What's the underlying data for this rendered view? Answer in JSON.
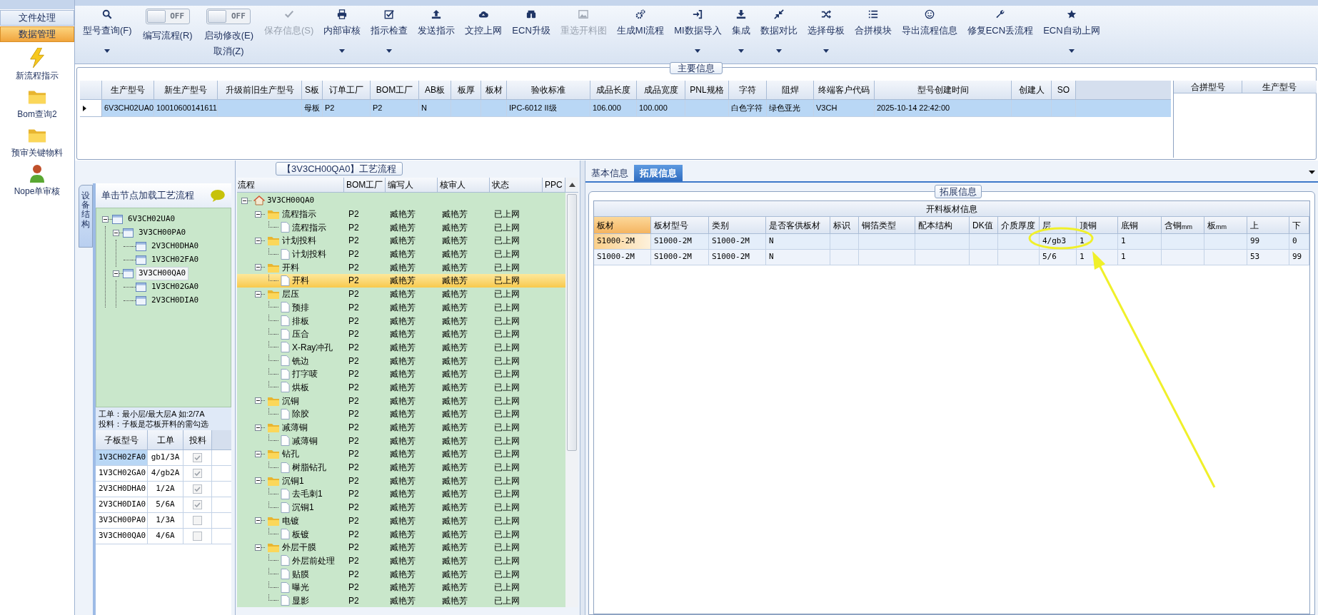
{
  "sidebar": {
    "sections": [
      {
        "label": "文件处理",
        "selected": false
      },
      {
        "label": "数据管理",
        "selected": true
      }
    ],
    "shortcuts": [
      {
        "label": "新流程指示"
      },
      {
        "label": "Bom查询2"
      },
      {
        "label": "预审关键物料"
      },
      {
        "label": "Nope单审核"
      }
    ]
  },
  "toolbar": [
    {
      "kind": "button",
      "label": "型号查询(F)",
      "dropdown": true,
      "disabled": false
    },
    {
      "kind": "toggle",
      "label": "编写流程(R)",
      "switch_text": "OFF",
      "on": false
    },
    {
      "kind": "toggle",
      "label": "启动修改(E)",
      "sublabel": "取消(Z)",
      "switch_text": "OFF",
      "on": false
    },
    {
      "kind": "button",
      "label": "保存信息(S)",
      "dropdown": false,
      "disabled": true
    },
    {
      "kind": "button",
      "label": "内部审核",
      "dropdown": true,
      "disabled": false
    },
    {
      "kind": "button",
      "label": "指示检查",
      "dropdown": true,
      "disabled": false
    },
    {
      "kind": "button",
      "label": "发送指示",
      "dropdown": false,
      "disabled": false
    },
    {
      "kind": "button",
      "label": "文控上网",
      "dropdown": false,
      "disabled": false
    },
    {
      "kind": "button",
      "label": "ECN升级",
      "dropdown": false,
      "disabled": false
    },
    {
      "kind": "button",
      "label": "重选开料图",
      "dropdown": false,
      "disabled": true
    },
    {
      "kind": "button",
      "label": "生成MI流程",
      "dropdown": false,
      "disabled": false
    },
    {
      "kind": "button",
      "label": "MI数据导入",
      "dropdown": true,
      "disabled": false
    },
    {
      "kind": "button",
      "label": "集成",
      "dropdown": true,
      "disabled": false
    },
    {
      "kind": "button",
      "label": "数据对比",
      "dropdown": true,
      "disabled": false
    },
    {
      "kind": "button",
      "label": "选择母板",
      "dropdown": true,
      "disabled": false
    },
    {
      "kind": "button",
      "label": "合拼模块",
      "dropdown": false,
      "disabled": false
    },
    {
      "kind": "button",
      "label": "导出流程信息",
      "dropdown": false,
      "disabled": false
    },
    {
      "kind": "button",
      "label": "修复ECN丢流程",
      "dropdown": false,
      "disabled": false
    },
    {
      "kind": "button",
      "label": "ECN自动上网",
      "dropdown": true,
      "disabled": false
    }
  ],
  "main_info": {
    "title": "主要信息",
    "columns": [
      "生产型号",
      "新生产型号",
      "升级前旧生产型号",
      "S板",
      "订单工厂",
      "BOM工厂",
      "AB板",
      "板厚",
      "板材",
      "验收标准",
      "成品长度",
      "成品宽度",
      "PNL规格",
      "字符",
      "阻焊",
      "终端客户代码",
      "型号创建时间",
      "创建人",
      "SO"
    ],
    "rows": [
      {
        "selected": true,
        "cells": [
          "6V3CH02UA0",
          "10010600141611",
          null,
          "母板",
          "P2",
          "P2",
          "N",
          null,
          null,
          "IPC-6012 II级",
          "106.000",
          "100.000",
          null,
          "白色字符",
          "绿色亚光",
          "V3CH",
          "2025-10-14 22:42:00",
          null,
          null
        ]
      }
    ],
    "side_table": {
      "columns": [
        "合拼型号",
        "生产型号"
      ]
    }
  },
  "structure_panel": {
    "tab": "设备结构",
    "header": "单击节点加载工艺流程",
    "tree": [
      {
        "label": "6V3CH02UA0",
        "expanded": true,
        "selected": false,
        "children": [
          {
            "label": "3V3CH00PA0",
            "expanded": true,
            "selected": false,
            "children": [
              {
                "label": "2V3CH0DHA0",
                "selected": false
              },
              {
                "label": "1V3CH02FA0",
                "selected": false
              }
            ]
          },
          {
            "label": "3V3CH00QA0",
            "expanded": true,
            "selected": true,
            "children": [
              {
                "label": "1V3CH02GA0",
                "selected": false
              },
              {
                "label": "2V3CH0DIA0",
                "selected": false
              }
            ]
          }
        ]
      }
    ],
    "notes": [
      "工单：最小层/最大层A 如:2/7A",
      "投料：子板是芯板开料的需勾选"
    ],
    "table": {
      "columns": [
        "子板型号",
        "工单",
        "投料"
      ],
      "rows": [
        {
          "board": "1V3CH02FA0",
          "order": "gb1/3A",
          "checked": true,
          "selected": true
        },
        {
          "board": "1V3CH02GA0",
          "order": "4/gb2A",
          "checked": true,
          "selected": false
        },
        {
          "board": "2V3CH0DHA0",
          "order": "1/2A",
          "checked": true,
          "selected": false
        },
        {
          "board": "2V3CH0DIA0",
          "order": "5/6A",
          "checked": true,
          "selected": false
        },
        {
          "board": "3V3CH00PA0",
          "order": "1/3A",
          "checked": false,
          "selected": false
        },
        {
          "board": "3V3CH00QA0",
          "order": "4/6A",
          "checked": false,
          "selected": false
        }
      ]
    }
  },
  "process_panel": {
    "title": "【3V3CH00QA0】工艺流程",
    "columns": [
      "流程",
      "BOM工厂",
      "编写人",
      "核审人",
      "状态",
      "PPC"
    ],
    "tree": {
      "label": "3V3CH00QA0",
      "expanded": true,
      "selected": false,
      "children": [
        {
          "label": "流程指示",
          "bom": "P2",
          "writer": "臧艳芳",
          "reviewer": "臧艳芳",
          "status": "已上网",
          "expanded": true,
          "selected": false,
          "children": [
            {
              "label": "流程指示",
              "bom": "P2",
              "writer": "臧艳芳",
              "reviewer": "臧艳芳",
              "status": "已上网",
              "selected": false
            }
          ]
        },
        {
          "label": "计划投料",
          "bom": "P2",
          "writer": "臧艳芳",
          "reviewer": "臧艳芳",
          "status": "已上网",
          "expanded": true,
          "selected": false,
          "children": [
            {
              "label": "计划投料",
              "bom": "P2",
              "writer": "臧艳芳",
              "reviewer": "臧艳芳",
              "status": "已上网",
              "selected": false
            }
          ]
        },
        {
          "label": "开料",
          "bom": "P2",
          "writer": "臧艳芳",
          "reviewer": "臧艳芳",
          "status": "已上网",
          "expanded": true,
          "selected": false,
          "children": [
            {
              "label": "开料",
              "bom": "P2",
              "writer": "臧艳芳",
              "reviewer": "臧艳芳",
              "status": "已上网",
              "selected": true
            }
          ]
        },
        {
          "label": "层压",
          "bom": "P2",
          "writer": "臧艳芳",
          "reviewer": "臧艳芳",
          "status": "已上网",
          "expanded": true,
          "selected": false,
          "children": [
            {
              "label": "预排",
              "bom": "P2",
              "writer": "臧艳芳",
              "reviewer": "臧艳芳",
              "status": "已上网",
              "selected": false
            },
            {
              "label": "排板",
              "bom": "P2",
              "writer": "臧艳芳",
              "reviewer": "臧艳芳",
              "status": "已上网",
              "selected": false
            },
            {
              "label": "压合",
              "bom": "P2",
              "writer": "臧艳芳",
              "reviewer": "臧艳芳",
              "status": "已上网",
              "selected": false
            },
            {
              "label": "X-Ray冲孔",
              "bom": "P2",
              "writer": "臧艳芳",
              "reviewer": "臧艳芳",
              "status": "已上网",
              "selected": false
            },
            {
              "label": "铣边",
              "bom": "P2",
              "writer": "臧艳芳",
              "reviewer": "臧艳芳",
              "status": "已上网",
              "selected": false
            },
            {
              "label": "打字唛",
              "bom": "P2",
              "writer": "臧艳芳",
              "reviewer": "臧艳芳",
              "status": "已上网",
              "selected": false
            },
            {
              "label": "烘板",
              "bom": "P2",
              "writer": "臧艳芳",
              "reviewer": "臧艳芳",
              "status": "已上网",
              "selected": false
            }
          ]
        },
        {
          "label": "沉铜",
          "bom": "P2",
          "writer": "臧艳芳",
          "reviewer": "臧艳芳",
          "status": "已上网",
          "expanded": true,
          "selected": false,
          "children": [
            {
              "label": "除胶",
              "bom": "P2",
              "writer": "臧艳芳",
              "reviewer": "臧艳芳",
              "status": "已上网",
              "selected": false
            }
          ]
        },
        {
          "label": "减薄铜",
          "bom": "P2",
          "writer": "臧艳芳",
          "reviewer": "臧艳芳",
          "status": "已上网",
          "expanded": true,
          "selected": false,
          "children": [
            {
              "label": "减薄铜",
              "bom": "P2",
              "writer": "臧艳芳",
              "reviewer": "臧艳芳",
              "status": "已上网",
              "selected": false
            }
          ]
        },
        {
          "label": "钻孔",
          "bom": "P2",
          "writer": "臧艳芳",
          "reviewer": "臧艳芳",
          "status": "已上网",
          "expanded": true,
          "selected": false,
          "children": [
            {
              "label": "树脂钻孔",
              "bom": "P2",
              "writer": "臧艳芳",
              "reviewer": "臧艳芳",
              "status": "已上网",
              "selected": false
            }
          ]
        },
        {
          "label": "沉铜1",
          "bom": "P2",
          "writer": "臧艳芳",
          "reviewer": "臧艳芳",
          "status": "已上网",
          "expanded": true,
          "selected": false,
          "children": [
            {
              "label": "去毛刺1",
              "bom": "P2",
              "writer": "臧艳芳",
              "reviewer": "臧艳芳",
              "status": "已上网",
              "selected": false
            },
            {
              "label": "沉铜1",
              "bom": "P2",
              "writer": "臧艳芳",
              "reviewer": "臧艳芳",
              "status": "已上网",
              "selected": false
            }
          ]
        },
        {
          "label": "电镀",
          "bom": "P2",
          "writer": "臧艳芳",
          "reviewer": "臧艳芳",
          "status": "已上网",
          "expanded": true,
          "selected": false,
          "children": [
            {
              "label": "板镀",
              "bom": "P2",
              "writer": "臧艳芳",
              "reviewer": "臧艳芳",
              "status": "已上网",
              "selected": false
            }
          ]
        },
        {
          "label": "外层干膜",
          "bom": "P2",
          "writer": "臧艳芳",
          "reviewer": "臧艳芳",
          "status": "已上网",
          "expanded": true,
          "selected": false,
          "children": [
            {
              "label": "外层前处理",
              "bom": "P2",
              "writer": "臧艳芳",
              "reviewer": "臧艳芳",
              "status": "已上网",
              "selected": false
            },
            {
              "label": "贴膜",
              "bom": "P2",
              "writer": "臧艳芳",
              "reviewer": "臧艳芳",
              "status": "已上网",
              "selected": false
            },
            {
              "label": "曝光",
              "bom": "P2",
              "writer": "臧艳芳",
              "reviewer": "臧艳芳",
              "status": "已上网",
              "selected": false
            },
            {
              "label": "显影",
              "bom": "P2",
              "writer": "臧艳芳",
              "reviewer": "臧艳芳",
              "status": "已上网",
              "selected": false
            }
          ]
        }
      ]
    }
  },
  "detail_panel": {
    "tabs": [
      {
        "label": "基本信息",
        "selected": false
      },
      {
        "label": "拓展信息",
        "selected": true
      }
    ],
    "group_title": "拓展信息",
    "table": {
      "caption": "开料板材信息",
      "columns": [
        "板材",
        "板材型号",
        "类别",
        "是否客供板材",
        "标识",
        "铜箔类型",
        "配本结构",
        "DK值",
        "介质厚度",
        "层",
        "顶铜",
        "底铜",
        "含铜$_{mm}$",
        "板$_{mm}$",
        "上",
        "下"
      ],
      "rows": [
        {
          "selected": true,
          "cells": [
            "S1000-2M",
            "S1000-2M",
            "S1000-2M",
            "N",
            null,
            null,
            null,
            null,
            null,
            "4/gb3",
            "1",
            "1",
            null,
            null,
            "99",
            "0"
          ]
        },
        {
          "selected": false,
          "cells": [
            "S1000-2M",
            "S1000-2M",
            "S1000-2M",
            "N",
            null,
            null,
            null,
            null,
            null,
            "5/6",
            "1",
            "1",
            null,
            null,
            "53",
            "99"
          ]
        }
      ]
    }
  }
}
